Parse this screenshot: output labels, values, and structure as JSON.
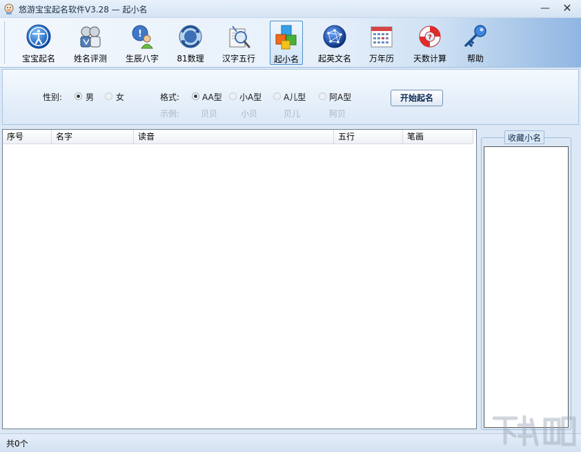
{
  "window": {
    "title": "悠游宝宝起名软件V3.28  —  起小名",
    "minimize_glyph": "—",
    "close_glyph": "✕"
  },
  "toolbar": {
    "items": [
      {
        "label": "宝宝起名",
        "icon": "accessibility-icon"
      },
      {
        "label": "姓名评测",
        "icon": "people-icon"
      },
      {
        "label": "生辰八字",
        "icon": "info-person-icon"
      },
      {
        "label": "81数理",
        "icon": "refresh-globe-icon"
      },
      {
        "label": "汉字五行",
        "icon": "magnifier-icon"
      },
      {
        "label": "起小名",
        "icon": "color-blocks-icon",
        "active": true
      },
      {
        "label": "起英文名",
        "icon": "globe-network-icon"
      },
      {
        "label": "万年历",
        "icon": "calendar-icon"
      },
      {
        "label": "天数计算",
        "icon": "lifebuoy-icon"
      },
      {
        "label": "帮助",
        "icon": "key-icon"
      }
    ]
  },
  "options": {
    "gender_label": "性别:",
    "gender_male": "男",
    "gender_female": "女",
    "gender_selected": "男",
    "format_label": "格式:",
    "example_label": "示例:",
    "formats": [
      {
        "label": "AA型",
        "example": "贝贝",
        "selected": true
      },
      {
        "label": "小A型",
        "example": "小贝",
        "selected": false
      },
      {
        "label": "A儿型",
        "example": "贝儿",
        "selected": false
      },
      {
        "label": "阿A型",
        "example": "阿贝",
        "selected": false
      }
    ],
    "start_button": "开始起名"
  },
  "list": {
    "columns": [
      "序号",
      "名字",
      "读音",
      "五行",
      "笔画"
    ],
    "rows": []
  },
  "favorites": {
    "title": "收藏小名"
  },
  "status": {
    "count_text": "共0个"
  },
  "colors": {
    "toolbar_accent": "#8fb6e2",
    "panel_bg": "#dce8f5",
    "button_text": "#0c2a55"
  }
}
